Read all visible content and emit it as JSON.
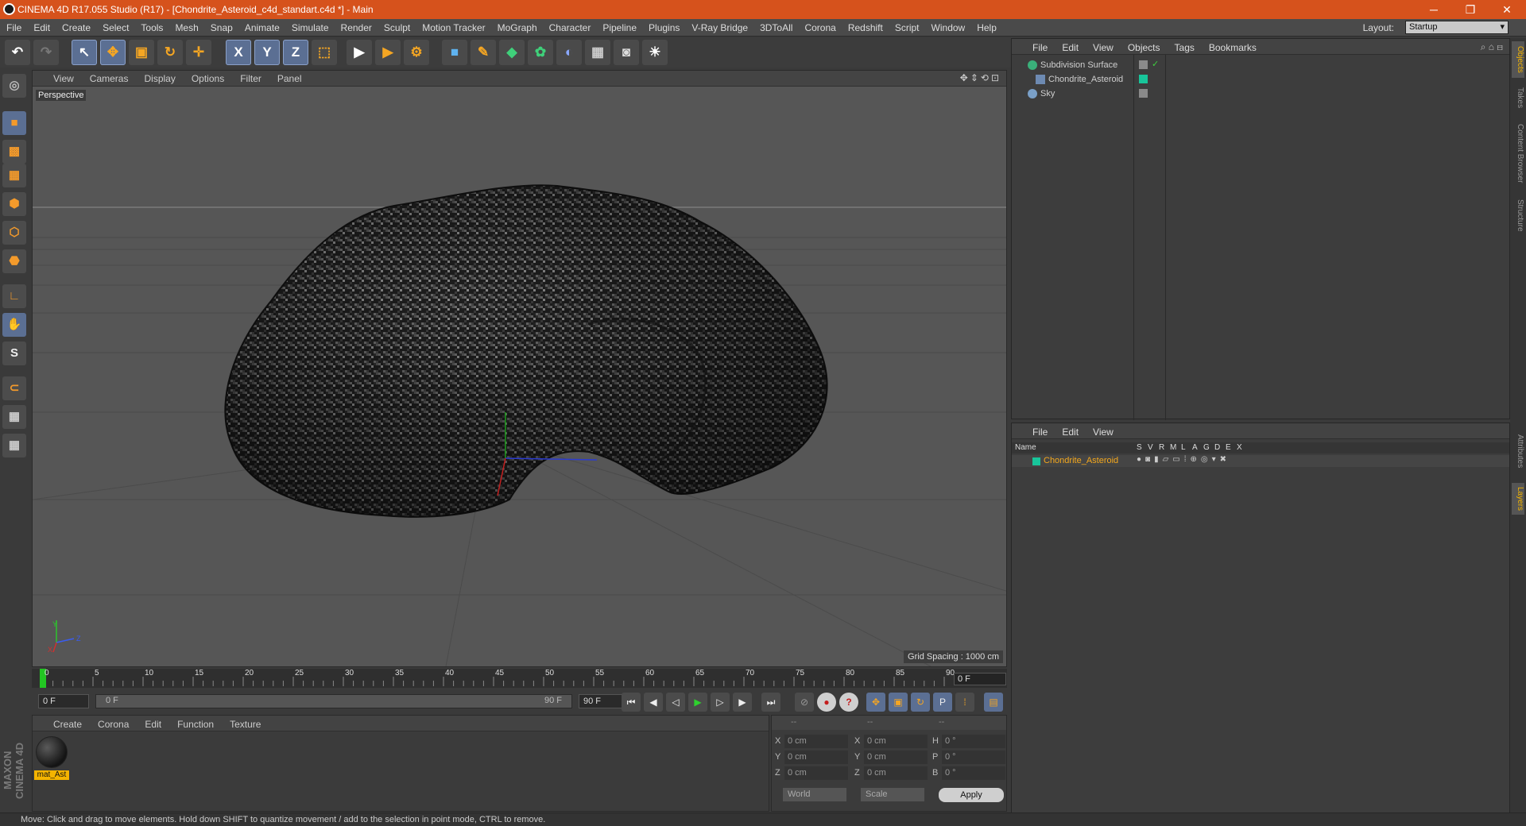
{
  "window": {
    "title": "CINEMA 4D R17.055 Studio (R17) - [Chondrite_Asteroid_c4d_standart.c4d *] - Main",
    "minimize": "─",
    "restore": "❐",
    "close": "✕"
  },
  "menubar": {
    "items": [
      "File",
      "Edit",
      "Create",
      "Select",
      "Tools",
      "Mesh",
      "Snap",
      "Animate",
      "Simulate",
      "Render",
      "Sculpt",
      "Motion Tracker",
      "MoGraph",
      "Character",
      "Pipeline",
      "Plugins",
      "V-Ray Bridge",
      "3DToAll",
      "Corona",
      "Redshift",
      "Script",
      "Window",
      "Help"
    ],
    "layout_label": "Layout:",
    "layout_value": "Startup"
  },
  "toolbar": {
    "undo": "↶",
    "redo": "↷",
    "select": "↖",
    "move": "✥",
    "scale": "▣",
    "rotate": "↻",
    "transform": "✛",
    "x": "X",
    "y": "Y",
    "z": "Z",
    "coord": "⬚",
    "render_view": "▶",
    "render": "▶",
    "render_settings": "⚙",
    "cube": "■",
    "pen": "✎",
    "subdiv": "◆",
    "cloner": "✿",
    "deformer": "◐",
    "floor": "▦",
    "camera": "◙",
    "light": "☀"
  },
  "viewport": {
    "menu": [
      "View",
      "Cameras",
      "Display",
      "Options",
      "Filter",
      "Panel"
    ],
    "label": "Perspective",
    "grid_spacing": "Grid Spacing : 1000 cm",
    "nav_icons": "✥⇕⟲⊡",
    "axis_x": "X",
    "axis_y": "Y",
    "axis_z": "Z"
  },
  "timeline": {
    "ticks": [
      "0",
      "5",
      "10",
      "15",
      "20",
      "25",
      "30",
      "35",
      "40",
      "45",
      "50",
      "55",
      "60",
      "65",
      "70",
      "75",
      "80",
      "85",
      "90"
    ],
    "current_frame": "0 F"
  },
  "playbar": {
    "start_field": "0 F",
    "range_start": "0 F",
    "range_end": "90 F",
    "end_field": "90 F",
    "btn_first": "⏮",
    "btn_prev_key": "◀",
    "btn_prev": "◁",
    "btn_play": "▶",
    "btn_next": "▷",
    "btn_next_key": "▶",
    "btn_last": "⏭"
  },
  "materials": {
    "menu": [
      "Create",
      "Corona",
      "Edit",
      "Function",
      "Texture"
    ],
    "items": [
      {
        "name": "mat_Ast"
      }
    ]
  },
  "coordinates": {
    "header": [
      "--",
      "--",
      "--"
    ],
    "rows": [
      {
        "l1": "X",
        "v1": "0 cm",
        "l2": "X",
        "v2": "0 cm",
        "l3": "H",
        "v3": "0 °"
      },
      {
        "l1": "Y",
        "v1": "0 cm",
        "l2": "Y",
        "v2": "0 cm",
        "l3": "P",
        "v3": "0 °"
      },
      {
        "l1": "Z",
        "v1": "0 cm",
        "l2": "Z",
        "v2": "0 cm",
        "l3": "B",
        "v3": "0 °"
      }
    ],
    "space": "World",
    "mode": "Scale",
    "apply": "Apply"
  },
  "objects": {
    "menu": [
      "File",
      "Edit",
      "View",
      "Objects",
      "Tags",
      "Bookmarks"
    ],
    "items": [
      {
        "name": "Subdivision Surface",
        "icon_color": "#3ab07a"
      },
      {
        "name": "Chondrite_Asteroid",
        "icon_color": "#18c59a"
      },
      {
        "name": "Sky",
        "icon_color": "#7aa0c8"
      }
    ]
  },
  "layers": {
    "menu": [
      "File",
      "Edit",
      "View"
    ],
    "columns": [
      "Name",
      "S",
      "V",
      "R",
      "M",
      "L",
      "A",
      "G",
      "D",
      "E",
      "X"
    ],
    "items": [
      {
        "name": "Chondrite_Asteroid",
        "color": "#18c59a"
      }
    ]
  },
  "right_tabs": [
    "Objects",
    "Takes",
    "Content Browser",
    "Structure",
    "Attributes",
    "Layers"
  ],
  "maxon_logo": "MAXON CINEMA 4D",
  "status": "Move: Click and drag to move elements. Hold down SHIFT to quantize movement / add to the selection in point mode, CTRL to remove."
}
